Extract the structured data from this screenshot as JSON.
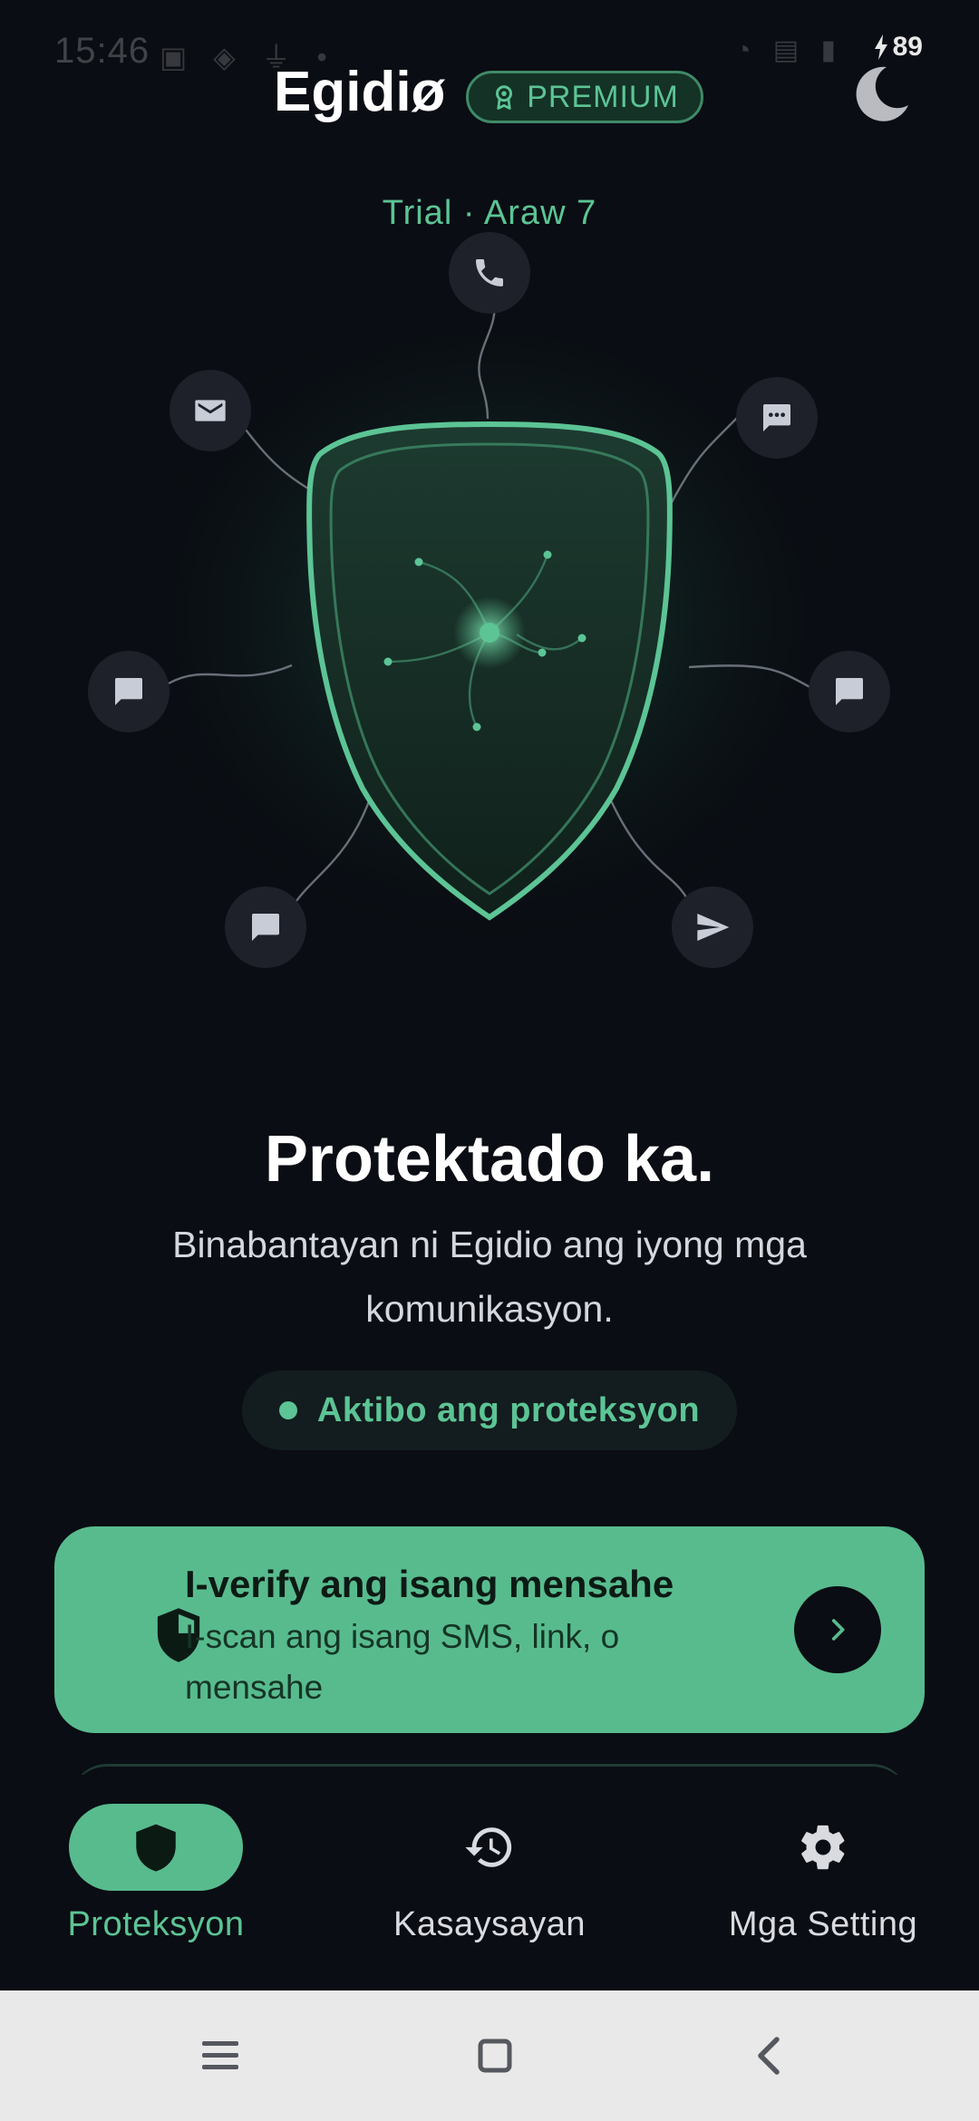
{
  "status_bar": {
    "time": "15:46",
    "left_icons": "▣ ◈ ⏚ •",
    "right_icons": "◔ ▤ ▮",
    "battery": "89"
  },
  "header": {
    "app_name": "Egidiø",
    "badge": "PREMIUM",
    "theme_icon": "moon-icon"
  },
  "trial": "Trial · Araw 7",
  "illustration": {
    "center": "shield-icon",
    "nodes": [
      "phone-icon",
      "email-icon",
      "sms-icon",
      "chat-icon",
      "chat-icon",
      "chat-icon",
      "send-icon"
    ]
  },
  "main": {
    "headline": "Protektado ka.",
    "subtitle": "Binabantayan ni Egidio ang iyong mga komunikasyon.",
    "status": "Aktibo ang proteksyon"
  },
  "verify_card": {
    "title": "I-verify ang isang mensahe",
    "subtitle": "I-scan ang isang SMS, link, o mensahe"
  },
  "bottom_nav": {
    "items": [
      {
        "label": "Proteksyon",
        "icon": "shield-icon",
        "active": true
      },
      {
        "label": "Kasaysayan",
        "icon": "history-icon",
        "active": false
      },
      {
        "label": "Mga Setting",
        "icon": "gear-icon",
        "active": false
      }
    ]
  },
  "system_nav": [
    "menu-icon",
    "home-icon",
    "back-icon"
  ],
  "colors": {
    "background": "#0a0d13",
    "accent": "#58bb8e",
    "accent_text": "#5cc495",
    "node_bg": "#1e2129"
  }
}
